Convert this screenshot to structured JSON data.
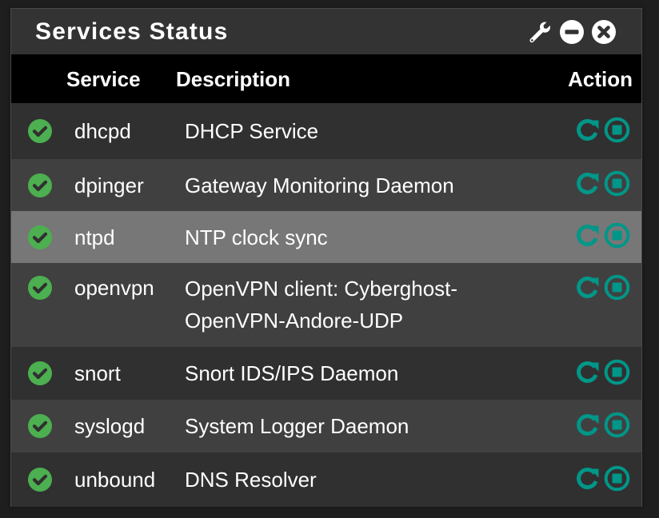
{
  "panel": {
    "title": "Services Status",
    "header_icons": [
      "wrench-icon",
      "minimize-icon",
      "close-icon"
    ]
  },
  "table": {
    "columns": {
      "service": "Service",
      "description": "Description",
      "action": "Action"
    },
    "rows": [
      {
        "status": "running",
        "service": "dhcpd",
        "description": "DHCP Service",
        "actions": [
          "restart",
          "stop"
        ]
      },
      {
        "status": "running",
        "service": "dpinger",
        "description": "Gateway Monitoring Daemon",
        "actions": [
          "restart",
          "stop"
        ]
      },
      {
        "status": "running",
        "service": "ntpd",
        "description": "NTP clock sync",
        "actions": [
          "restart",
          "stop"
        ],
        "highlighted": true
      },
      {
        "status": "running",
        "service": "openvpn",
        "description": "OpenVPN client: Cyberghost-OpenVPN-Andore-UDP",
        "actions": [
          "restart",
          "stop"
        ]
      },
      {
        "status": "running",
        "service": "snort",
        "description": "Snort IDS/IPS Daemon",
        "actions": [
          "restart",
          "stop"
        ]
      },
      {
        "status": "running",
        "service": "syslogd",
        "description": "System Logger Daemon",
        "actions": [
          "restart",
          "stop"
        ]
      },
      {
        "status": "running",
        "service": "unbound",
        "description": "DNS Resolver",
        "actions": [
          "restart",
          "stop"
        ]
      }
    ]
  },
  "colors": {
    "status_running": "#4caf50",
    "action_icon": "#009688",
    "header_bg": "#000000",
    "highlight_row": "#777777"
  }
}
